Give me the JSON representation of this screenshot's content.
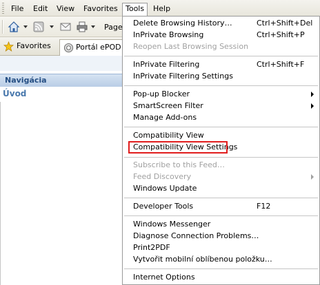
{
  "menubar": {
    "items": [
      "File",
      "Edit",
      "View",
      "Favorites",
      "Tools",
      "Help"
    ]
  },
  "toolbar": {
    "page_label": "Page",
    "icons": [
      "home-icon",
      "feeds-icon",
      "mail-icon",
      "print-icon"
    ]
  },
  "favorites_bar": {
    "favorites_label": "Favorites",
    "tab_title": "Portál ePOD -"
  },
  "page": {
    "nav_header": "Navigácia",
    "home_link": "Úvod"
  },
  "tools_menu": {
    "groups": [
      [
        {
          "label": "Delete Browsing History…",
          "shortcut": "Ctrl+Shift+Del",
          "disabled": false
        },
        {
          "label": "InPrivate Browsing",
          "shortcut": "Ctrl+Shift+P",
          "disabled": false
        },
        {
          "label": "Reopen Last Browsing Session",
          "shortcut": "",
          "disabled": true
        }
      ],
      [
        {
          "label": "InPrivate Filtering",
          "shortcut": "Ctrl+Shift+F",
          "disabled": false
        },
        {
          "label": "InPrivate Filtering Settings",
          "shortcut": "",
          "disabled": false
        }
      ],
      [
        {
          "label": "Pop-up Blocker",
          "submenu": true,
          "disabled": false
        },
        {
          "label": "SmartScreen Filter",
          "submenu": true,
          "disabled": false
        },
        {
          "label": "Manage Add-ons",
          "disabled": false
        }
      ],
      [
        {
          "label": "Compatibility View",
          "disabled": false
        },
        {
          "label": "Compatibility View Settings",
          "disabled": false,
          "highlighted": true
        }
      ],
      [
        {
          "label": "Subscribe to this Feed…",
          "disabled": true
        },
        {
          "label": "Feed Discovery",
          "submenu": true,
          "disabled": true
        },
        {
          "label": "Windows Update",
          "disabled": false
        }
      ],
      [
        {
          "label": "Developer Tools",
          "shortcut": "F12",
          "disabled": false
        }
      ],
      [
        {
          "label": "Windows Messenger",
          "disabled": false
        },
        {
          "label": "Diagnose Connection Problems…",
          "disabled": false
        },
        {
          "label": "Print2PDF",
          "disabled": false
        },
        {
          "label": "Vytvořit mobilní oblíbenou položku…",
          "disabled": false
        }
      ],
      [
        {
          "label": "Internet Options",
          "disabled": false
        }
      ]
    ]
  },
  "colors": {
    "highlight_border": "#e11c1c",
    "nav_header_text": "#264f84",
    "home_link": "#4a79ad",
    "disabled_text": "#a0a0a0"
  }
}
